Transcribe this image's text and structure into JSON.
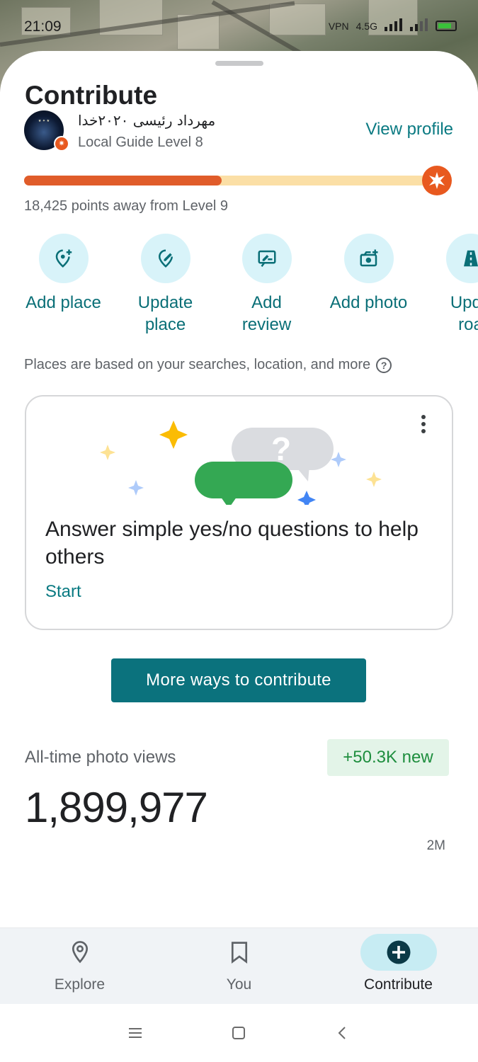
{
  "status_bar": {
    "time": "21:09",
    "network": "4.5G",
    "vpn": "VPN"
  },
  "header": {
    "title": "Contribute"
  },
  "profile": {
    "name": "مهرداد رئیسی ۲۰۲۰خدا",
    "level": "Local Guide Level 8",
    "view_profile": "View profile",
    "progress_fraction": 0.49,
    "points_away": "18,425 points away from Level 9"
  },
  "actions": [
    {
      "label_line1": "Add",
      "label_line2": "place",
      "label": "Add place",
      "icon": "add-place-icon"
    },
    {
      "label_line1": "Update",
      "label_line2": "place",
      "label": "Update place",
      "icon": "edit-place-icon"
    },
    {
      "label_line1": "Add",
      "label_line2": "review",
      "label": "Add review",
      "icon": "review-icon"
    },
    {
      "label_line1": "Add",
      "label_line2": "photo",
      "label": "Add photo",
      "icon": "add-photo-icon"
    },
    {
      "label_line1": "Upda",
      "label_line2": "roa",
      "label": "Update road",
      "icon": "road-icon"
    }
  ],
  "places_note": "Places are based on your searches, location, and more",
  "card": {
    "question_text": "Answer simple yes/no questions to help others",
    "start_label": "Start"
  },
  "more_button": "More ways to contribute",
  "photo_views": {
    "label": "All-time photo views",
    "badge": "+50.3K new",
    "value": "1,899,977",
    "axis_label": "2M"
  },
  "bottom_nav": [
    {
      "label": "Explore",
      "icon": "location-pin-icon",
      "active": false
    },
    {
      "label": "You",
      "icon": "bookmark-icon",
      "active": false
    },
    {
      "label": "Contribute",
      "icon": "add-circle-icon",
      "active": true
    }
  ],
  "colors": {
    "accent": "#0b727d",
    "progress_fill": "#e05c2a",
    "progress_track": "#fbdfa6",
    "badge_green": "#1e8e3e"
  }
}
